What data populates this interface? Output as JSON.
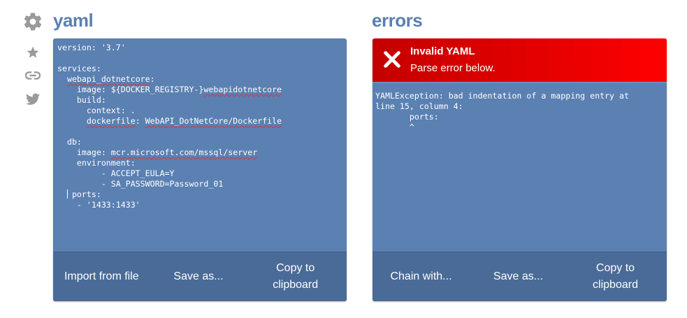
{
  "sidebar": {
    "icons": [
      "gear-icon",
      "star-icon",
      "link-icon",
      "twitter-icon"
    ]
  },
  "left_panel": {
    "title": "yaml",
    "code_lines": [
      "version: '3.7'",
      "",
      "services:",
      "  webapi_dotnetcore:",
      "    image: ${DOCKER_REGISTRY-}webapidotnetcore",
      "    build:",
      "      context: .",
      "      dockerfile: WebAPI_DotNetCore/Dockerfile",
      "",
      "  db:",
      "    image: mcr.microsoft.com/mssql/server",
      "    environment:",
      "         - ACCEPT_EULA=Y",
      "         - SA_PASSWORD=Password_01",
      "   ports:",
      "    - '1433:1433'"
    ],
    "buttons": {
      "import": "Import from file",
      "save": "Save as...",
      "copy_line1": "Copy to",
      "copy_line2": "clipboard"
    }
  },
  "right_panel": {
    "title": "errors",
    "error_title": "Invalid YAML",
    "error_subtitle": "Parse error below.",
    "error_message": "YAMLException: bad indentation of a mapping entry at\nline 15, column 4:\n       ports:\n       ^",
    "buttons": {
      "chain": "Chain with...",
      "save": "Save as...",
      "copy_line1": "Copy to",
      "copy_line2": "clipboard"
    }
  },
  "colors": {
    "accent": "#5b80b2",
    "footer": "#4a6b97",
    "error": "#e60000",
    "icon_gray": "#9a9a9a"
  }
}
